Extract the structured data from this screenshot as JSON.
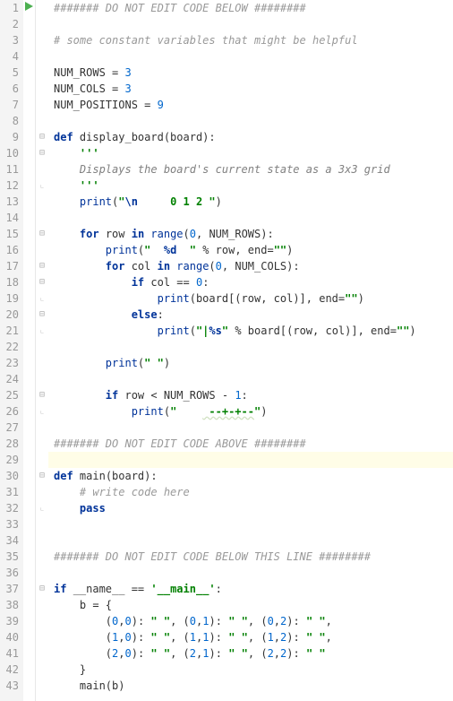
{
  "code": {
    "lines": [
      {
        "n": 1,
        "icon": "run",
        "fold": "",
        "segments": [
          {
            "t": "####### DO NOT EDIT CODE BELOW ########",
            "cls": "c-cmt"
          }
        ]
      },
      {
        "n": 2,
        "segments": []
      },
      {
        "n": 3,
        "segments": [
          {
            "t": "# some constant variables that might be helpful",
            "cls": "c-cmt"
          }
        ]
      },
      {
        "n": 4,
        "segments": []
      },
      {
        "n": 5,
        "segments": [
          {
            "t": "NUM_ROWS = ",
            "cls": ""
          },
          {
            "t": "3",
            "cls": "c-num"
          }
        ]
      },
      {
        "n": 6,
        "segments": [
          {
            "t": "NUM_COLS = ",
            "cls": ""
          },
          {
            "t": "3",
            "cls": "c-num"
          }
        ]
      },
      {
        "n": 7,
        "segments": [
          {
            "t": "NUM_POSITIONS = ",
            "cls": ""
          },
          {
            "t": "9",
            "cls": "c-num"
          }
        ]
      },
      {
        "n": 8,
        "segments": []
      },
      {
        "n": 9,
        "fold": "minus",
        "segments": [
          {
            "t": "def ",
            "cls": "c-kw"
          },
          {
            "t": "display_board",
            "cls": "c-def"
          },
          {
            "t": "(board):",
            "cls": ""
          }
        ]
      },
      {
        "n": 10,
        "fold": "minus",
        "segments": [
          {
            "t": "    ",
            "cls": ""
          },
          {
            "t": "'''",
            "cls": "c-docq"
          }
        ]
      },
      {
        "n": 11,
        "segments": [
          {
            "t": "    Displays the board's current state as a 3x3 grid",
            "cls": "c-doc"
          }
        ]
      },
      {
        "n": 12,
        "fold": "end",
        "segments": [
          {
            "t": "    ",
            "cls": ""
          },
          {
            "t": "'''",
            "cls": "c-docq"
          }
        ]
      },
      {
        "n": 13,
        "segments": [
          {
            "t": "    ",
            "cls": ""
          },
          {
            "t": "print",
            "cls": "c-bi"
          },
          {
            "t": "(",
            "cls": ""
          },
          {
            "t": "\"",
            "cls": "c-str"
          },
          {
            "t": "\\n",
            "cls": "c-esc"
          },
          {
            "t": "     0 1 2 \"",
            "cls": "c-str"
          },
          {
            "t": ")",
            "cls": ""
          }
        ]
      },
      {
        "n": 14,
        "segments": []
      },
      {
        "n": 15,
        "fold": "minus",
        "segments": [
          {
            "t": "    ",
            "cls": ""
          },
          {
            "t": "for ",
            "cls": "c-kw"
          },
          {
            "t": "row ",
            "cls": ""
          },
          {
            "t": "in ",
            "cls": "c-kw"
          },
          {
            "t": "range",
            "cls": "c-bi"
          },
          {
            "t": "(",
            "cls": ""
          },
          {
            "t": "0",
            "cls": "c-num"
          },
          {
            "t": ", NUM_ROWS):",
            "cls": ""
          }
        ]
      },
      {
        "n": 16,
        "segments": [
          {
            "t": "        ",
            "cls": ""
          },
          {
            "t": "print",
            "cls": "c-bi"
          },
          {
            "t": "(",
            "cls": ""
          },
          {
            "t": "\"  ",
            "cls": "c-str"
          },
          {
            "t": "%d",
            "cls": "c-esc"
          },
          {
            "t": "  \"",
            "cls": "c-str"
          },
          {
            "t": " % row, ",
            "cls": ""
          },
          {
            "t": "end",
            "cls": ""
          },
          {
            "t": "=",
            "cls": ""
          },
          {
            "t": "\"\"",
            "cls": "c-str"
          },
          {
            "t": ")",
            "cls": ""
          }
        ]
      },
      {
        "n": 17,
        "fold": "minus",
        "segments": [
          {
            "t": "        ",
            "cls": ""
          },
          {
            "t": "for ",
            "cls": "c-kw"
          },
          {
            "t": "col ",
            "cls": ""
          },
          {
            "t": "in ",
            "cls": "c-kw"
          },
          {
            "t": "range",
            "cls": "c-bi"
          },
          {
            "t": "(",
            "cls": ""
          },
          {
            "t": "0",
            "cls": "c-num"
          },
          {
            "t": ", NUM_COLS):",
            "cls": ""
          }
        ]
      },
      {
        "n": 18,
        "fold": "minus",
        "segments": [
          {
            "t": "            ",
            "cls": ""
          },
          {
            "t": "if ",
            "cls": "c-kw"
          },
          {
            "t": "col == ",
            "cls": ""
          },
          {
            "t": "0",
            "cls": "c-num"
          },
          {
            "t": ":",
            "cls": ""
          }
        ]
      },
      {
        "n": 19,
        "fold": "end",
        "segments": [
          {
            "t": "                ",
            "cls": ""
          },
          {
            "t": "print",
            "cls": "c-bi"
          },
          {
            "t": "(board[(row, col)], ",
            "cls": ""
          },
          {
            "t": "end",
            "cls": ""
          },
          {
            "t": "=",
            "cls": ""
          },
          {
            "t": "\"\"",
            "cls": "c-str"
          },
          {
            "t": ")",
            "cls": ""
          }
        ]
      },
      {
        "n": 20,
        "fold": "minus",
        "segments": [
          {
            "t": "            ",
            "cls": ""
          },
          {
            "t": "else",
            "cls": "c-kw"
          },
          {
            "t": ":",
            "cls": ""
          }
        ]
      },
      {
        "n": 21,
        "fold": "end",
        "segments": [
          {
            "t": "                ",
            "cls": ""
          },
          {
            "t": "print",
            "cls": "c-bi"
          },
          {
            "t": "(",
            "cls": ""
          },
          {
            "t": "\"|",
            "cls": "c-str"
          },
          {
            "t": "%s",
            "cls": "c-esc"
          },
          {
            "t": "\"",
            "cls": "c-str"
          },
          {
            "t": " % board[(row, col)], ",
            "cls": ""
          },
          {
            "t": "end",
            "cls": ""
          },
          {
            "t": "=",
            "cls": ""
          },
          {
            "t": "\"\"",
            "cls": "c-str"
          },
          {
            "t": ")",
            "cls": ""
          }
        ]
      },
      {
        "n": 22,
        "segments": []
      },
      {
        "n": 23,
        "segments": [
          {
            "t": "        ",
            "cls": ""
          },
          {
            "t": "print",
            "cls": "c-bi"
          },
          {
            "t": "(",
            "cls": ""
          },
          {
            "t": "\" \"",
            "cls": "c-str"
          },
          {
            "t": ")",
            "cls": ""
          }
        ]
      },
      {
        "n": 24,
        "segments": []
      },
      {
        "n": 25,
        "fold": "minus",
        "segments": [
          {
            "t": "        ",
            "cls": ""
          },
          {
            "t": "if ",
            "cls": "c-kw"
          },
          {
            "t": "row < NUM_ROWS - ",
            "cls": ""
          },
          {
            "t": "1",
            "cls": "c-num"
          },
          {
            "t": ":",
            "cls": ""
          }
        ]
      },
      {
        "n": 26,
        "fold": "end",
        "segments": [
          {
            "t": "            ",
            "cls": ""
          },
          {
            "t": "print",
            "cls": "c-bi"
          },
          {
            "t": "(",
            "cls": ""
          },
          {
            "t": "\"    ",
            "cls": "c-str"
          },
          {
            "t": " --+-+--",
            "cls": "c-str c-spell"
          },
          {
            "t": "\"",
            "cls": "c-str"
          },
          {
            "t": ")",
            "cls": ""
          }
        ]
      },
      {
        "n": 27,
        "segments": []
      },
      {
        "n": 28,
        "segments": [
          {
            "t": "####### DO NOT EDIT CODE ABOVE ########",
            "cls": "c-cmt"
          }
        ]
      },
      {
        "n": 29,
        "hl": true,
        "segments": []
      },
      {
        "n": 30,
        "fold": "minus",
        "segments": [
          {
            "t": "def ",
            "cls": "c-kw"
          },
          {
            "t": "main",
            "cls": "c-def"
          },
          {
            "t": "(board):",
            "cls": ""
          }
        ]
      },
      {
        "n": 31,
        "segments": [
          {
            "t": "    ",
            "cls": ""
          },
          {
            "t": "# write code here",
            "cls": "c-cmt"
          }
        ]
      },
      {
        "n": 32,
        "fold": "end",
        "segments": [
          {
            "t": "    ",
            "cls": ""
          },
          {
            "t": "pass",
            "cls": "c-kw"
          }
        ]
      },
      {
        "n": 33,
        "segments": []
      },
      {
        "n": 34,
        "segments": []
      },
      {
        "n": 35,
        "segments": [
          {
            "t": "####### DO NOT EDIT CODE BELOW THIS LINE ########",
            "cls": "c-cmt"
          }
        ]
      },
      {
        "n": 36,
        "segments": []
      },
      {
        "n": 37,
        "fold": "minus",
        "segments": [
          {
            "t": "if ",
            "cls": "c-kw"
          },
          {
            "t": "__name__ == ",
            "cls": ""
          },
          {
            "t": "'__main__'",
            "cls": "c-str"
          },
          {
            "t": ":",
            "cls": ""
          }
        ]
      },
      {
        "n": 38,
        "segments": [
          {
            "t": "    b = {",
            "cls": ""
          }
        ]
      },
      {
        "n": 39,
        "segments": [
          {
            "t": "        (",
            "cls": ""
          },
          {
            "t": "0",
            "cls": "c-num"
          },
          {
            "t": ",",
            "cls": ""
          },
          {
            "t": "0",
            "cls": "c-num"
          },
          {
            "t": "): ",
            "cls": ""
          },
          {
            "t": "\" \"",
            "cls": "c-str"
          },
          {
            "t": ", (",
            "cls": ""
          },
          {
            "t": "0",
            "cls": "c-num"
          },
          {
            "t": ",",
            "cls": ""
          },
          {
            "t": "1",
            "cls": "c-num"
          },
          {
            "t": "): ",
            "cls": ""
          },
          {
            "t": "\" \"",
            "cls": "c-str"
          },
          {
            "t": ", (",
            "cls": ""
          },
          {
            "t": "0",
            "cls": "c-num"
          },
          {
            "t": ",",
            "cls": ""
          },
          {
            "t": "2",
            "cls": "c-num"
          },
          {
            "t": "): ",
            "cls": ""
          },
          {
            "t": "\" \"",
            "cls": "c-str"
          },
          {
            "t": ",",
            "cls": ""
          }
        ]
      },
      {
        "n": 40,
        "segments": [
          {
            "t": "        (",
            "cls": ""
          },
          {
            "t": "1",
            "cls": "c-num"
          },
          {
            "t": ",",
            "cls": ""
          },
          {
            "t": "0",
            "cls": "c-num"
          },
          {
            "t": "): ",
            "cls": ""
          },
          {
            "t": "\" \"",
            "cls": "c-str"
          },
          {
            "t": ", (",
            "cls": ""
          },
          {
            "t": "1",
            "cls": "c-num"
          },
          {
            "t": ",",
            "cls": ""
          },
          {
            "t": "1",
            "cls": "c-num"
          },
          {
            "t": "): ",
            "cls": ""
          },
          {
            "t": "\" \"",
            "cls": "c-str"
          },
          {
            "t": ", (",
            "cls": ""
          },
          {
            "t": "1",
            "cls": "c-num"
          },
          {
            "t": ",",
            "cls": ""
          },
          {
            "t": "2",
            "cls": "c-num"
          },
          {
            "t": "): ",
            "cls": ""
          },
          {
            "t": "\" \"",
            "cls": "c-str"
          },
          {
            "t": ",",
            "cls": ""
          }
        ]
      },
      {
        "n": 41,
        "segments": [
          {
            "t": "        (",
            "cls": ""
          },
          {
            "t": "2",
            "cls": "c-num"
          },
          {
            "t": ",",
            "cls": ""
          },
          {
            "t": "0",
            "cls": "c-num"
          },
          {
            "t": "): ",
            "cls": ""
          },
          {
            "t": "\" \"",
            "cls": "c-str"
          },
          {
            "t": ", (",
            "cls": ""
          },
          {
            "t": "2",
            "cls": "c-num"
          },
          {
            "t": ",",
            "cls": ""
          },
          {
            "t": "1",
            "cls": "c-num"
          },
          {
            "t": "): ",
            "cls": ""
          },
          {
            "t": "\" \"",
            "cls": "c-str"
          },
          {
            "t": ", (",
            "cls": ""
          },
          {
            "t": "2",
            "cls": "c-num"
          },
          {
            "t": ",",
            "cls": ""
          },
          {
            "t": "2",
            "cls": "c-num"
          },
          {
            "t": "): ",
            "cls": ""
          },
          {
            "t": "\" \"",
            "cls": "c-str"
          }
        ]
      },
      {
        "n": 42,
        "segments": [
          {
            "t": "    }",
            "cls": ""
          }
        ]
      },
      {
        "n": 43,
        "segments": [
          {
            "t": "    main(b)",
            "cls": ""
          }
        ]
      }
    ]
  }
}
